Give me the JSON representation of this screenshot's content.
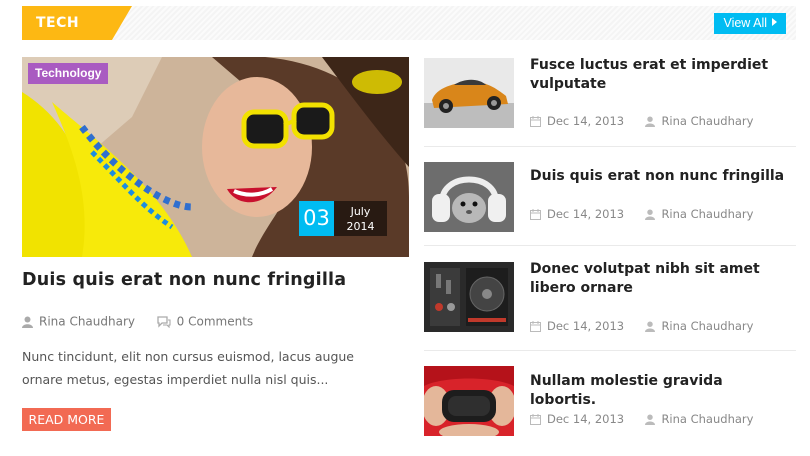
{
  "section": {
    "tag": "TECH",
    "view_all": "View All"
  },
  "featured": {
    "category": "Technology",
    "date_day": "03",
    "date_month": "July",
    "date_year": "2014",
    "title": "Duis quis erat non nunc fringilla",
    "author": "Rina Chaudhary",
    "comments": "0 Comments",
    "excerpt": "Nunc tincidunt, elit non cursus euismod, lacus augue ornare metus, egestas imperdiet nulla nisl quis...",
    "read_more": "READ MORE"
  },
  "list": [
    {
      "title": "Fusce luctus erat et imperdiet vulputate",
      "date": "Dec 14, 2013",
      "author": "Rina Chaudhary"
    },
    {
      "title": "Duis quis erat non nunc fringilla",
      "date": "Dec 14, 2013",
      "author": "Rina Chaudhary"
    },
    {
      "title": "Donec volutpat nibh sit amet libero ornare",
      "date": "Dec 14, 2013",
      "author": "Rina Chaudhary"
    },
    {
      "title": "Nullam molestie gravida lobortis.",
      "date": "Dec 14, 2013",
      "author": "Rina Chaudhary"
    }
  ],
  "colors": {
    "accent_yellow": "#fdb813",
    "accent_blue": "#00bcf2",
    "category_purple": "#a95bc1",
    "read_more_red": "#f26a53"
  }
}
